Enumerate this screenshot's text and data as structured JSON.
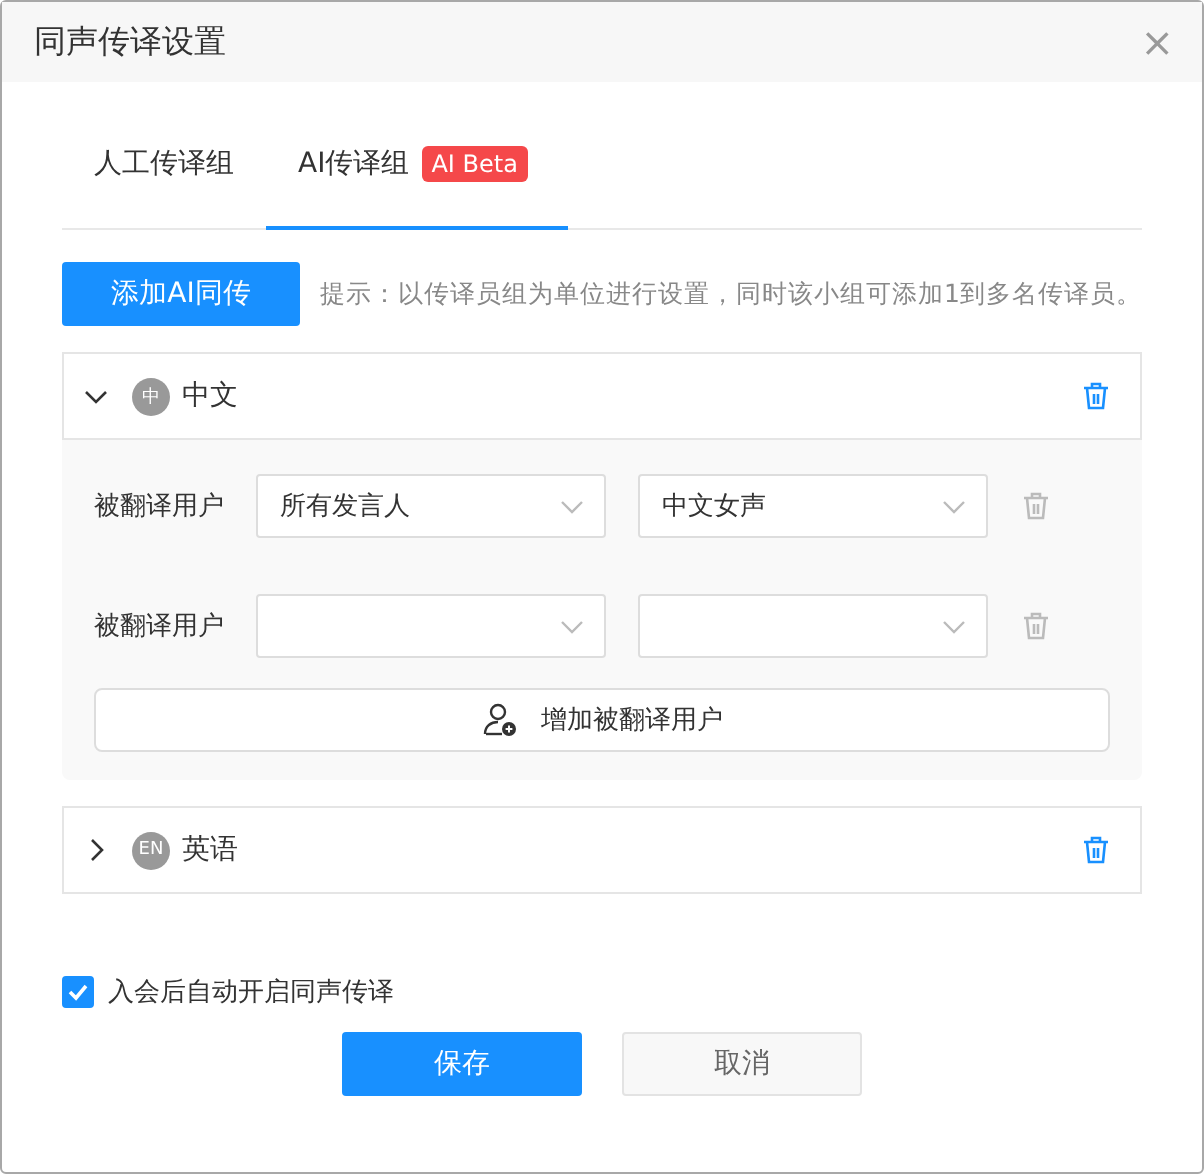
{
  "dialog": {
    "title": "同声传译设置",
    "close": "×"
  },
  "tabs": [
    {
      "label": "人工传译组",
      "selected": false
    },
    {
      "label": "AI传译组",
      "badge": "AI Beta",
      "selected": true
    }
  ],
  "add_button": "添加AI同传",
  "hint": "提示：以传译员组为单位进行设置，同时该小组可添加1到多名传译员。",
  "groups": [
    {
      "badge": "中",
      "name": "中文",
      "expanded": true,
      "rows": [
        {
          "label": "被翻译用户",
          "speaker": "所有发言人",
          "voice": "中文女声"
        },
        {
          "label": "被翻译用户"
        }
      ],
      "add_user": "增加被翻译用户"
    },
    {
      "badge": "EN",
      "name": "英语",
      "expanded": false
    }
  ],
  "auto_start": {
    "label": "入会后自动开启同声传译",
    "checked": true
  },
  "buttons": [
    {
      "label": "保存",
      "kind": "primary"
    },
    {
      "label": "取消",
      "kind": "secondary"
    }
  ]
}
